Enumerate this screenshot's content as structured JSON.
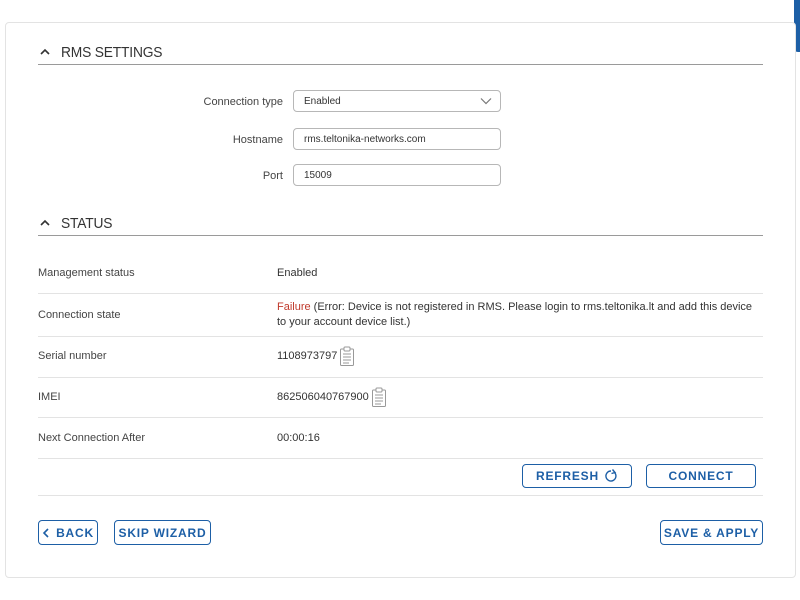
{
  "rms_settings": {
    "title": "RMS SETTINGS",
    "connection_type": {
      "label": "Connection type",
      "value": "Enabled"
    },
    "hostname": {
      "label": "Hostname",
      "value": "rms.teltonika-networks.com"
    },
    "port": {
      "label": "Port",
      "value": "15009"
    }
  },
  "status": {
    "title": "STATUS",
    "rows": [
      {
        "key": "Management status",
        "value": "Enabled"
      },
      {
        "key": "Connection state",
        "value_status": "Failure",
        "value_detail": " (Error: Device is not registered in RMS. Please login to rms.teltonika.lt and add this device to your account device list.)"
      },
      {
        "key": "Serial number",
        "value": "1108973797"
      },
      {
        "key": "IMEI",
        "value": "862506040767900"
      },
      {
        "key": "Next Connection After",
        "value": "00:00:16"
      }
    ]
  },
  "actions": {
    "refresh": "REFRESH",
    "connect": "CONNECT",
    "back": "BACK",
    "skip_wizard": "SKIP WIZARD",
    "save_apply": "SAVE & APPLY"
  },
  "colors": {
    "accent": "#1d5fa6",
    "failure": "#c0392b"
  },
  "icons": [
    "chevron-up-icon",
    "chevron-down-icon",
    "clipboard-icon",
    "refresh-icon",
    "chevron-left-icon"
  ]
}
